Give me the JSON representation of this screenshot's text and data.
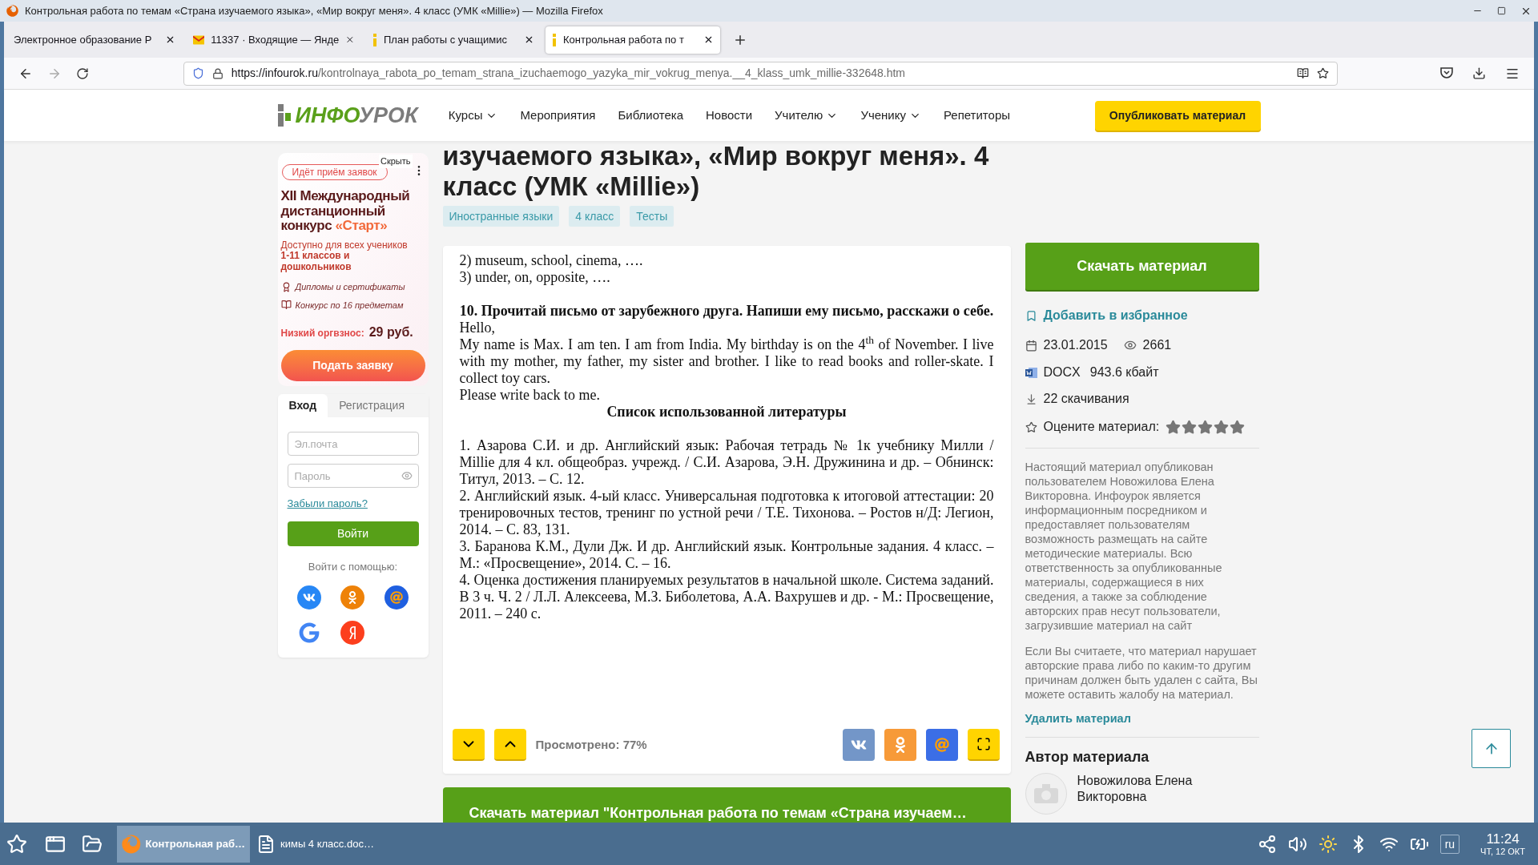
{
  "window": {
    "title": "Контрольная работа по темам «Страна изучаемого языка», «Мир вокруг меня». 4 класс (УМК «Millie») — Mozilla Firefox"
  },
  "tabs": [
    {
      "label": "Электронное образование Р",
      "selected": false,
      "kind": "none"
    },
    {
      "label": "11337 · Входящие — Янде",
      "selected": false,
      "kind": "mail"
    },
    {
      "label": "План работы с учащимис",
      "selected": false,
      "kind": "site"
    },
    {
      "label": "Контрольная работа по т",
      "selected": true,
      "kind": "site"
    }
  ],
  "address_bar": {
    "host": "https://infourok.ru",
    "path": "/kontrolnaya_rabota_po_temam_strana_izuchaemogo_yazyka_mir_vokrug_menya.__4_klass_umk_millie-332648.htm"
  },
  "site_header": {
    "logo": [
      "ИНФО",
      "УРОК"
    ],
    "nav": [
      {
        "label": "Курсы",
        "dropdown": true
      },
      {
        "label": "Мероприятия",
        "dropdown": false
      },
      {
        "label": "Библиотека",
        "dropdown": false
      },
      {
        "label": "Новости",
        "dropdown": false
      },
      {
        "label": "Учителю",
        "dropdown": true
      },
      {
        "label": "Ученику",
        "dropdown": true
      },
      {
        "label": "Репетиторы",
        "dropdown": false
      }
    ],
    "publish_button": "Опубликовать материал"
  },
  "ad": {
    "hide": "Скрыть",
    "badge": "Идёт приём заявок",
    "title": "XII Международный дистанционный конкурс",
    "title_accent": "«Старт»",
    "subtitle": "Доступно для всех учеников **1-11 классов и дошкольников**",
    "features": [
      {
        "kind": "diploma",
        "text": "Дипломы и сертификаты"
      },
      {
        "kind": "book",
        "text": "Конкурс по 16 предметам"
      }
    ],
    "fee_label": "Низкий оргвзнос:",
    "fee": "29 руб.",
    "button": "Подать заявку"
  },
  "login": {
    "tabs": [
      {
        "label": "Вход",
        "selected": true
      },
      {
        "label": "Регистрация",
        "selected": false
      }
    ],
    "email_placeholder": "Эл.почта",
    "password_placeholder": "Пароль",
    "forgot_link": "Забыли пароль?",
    "submit": "Войти",
    "social_label": "Войти с помощью:",
    "social": [
      {
        "kind": "vk"
      },
      {
        "kind": "ok"
      },
      {
        "kind": "mail"
      },
      {
        "kind": "google"
      },
      {
        "kind": "yandex"
      }
    ]
  },
  "material": {
    "title_lines": [
      "изучаемого языка», «Мир вокруг меня». 4",
      "класс (УМК «Millie»)"
    ],
    "tags": [
      "Иностранные языки",
      "4 класс",
      "Тесты"
    ]
  },
  "document": {
    "sections": [
      {
        "blocks": [
          {
            "kind": "plain",
            "text": "2) museum, school, cinema,  …."
          },
          {
            "kind": "plain",
            "text": "3)  under, on, opposite, …."
          }
        ]
      },
      {
        "blocks": [
          {
            "kind": "heading",
            "text": "10. Прочитай письмо от зарубежного друга. Напиши ему письмо, расскажи о себе."
          },
          {
            "kind": "plain",
            "text": "Hello,"
          },
          {
            "kind": "justified",
            "text": "My name is Max. I am ten. I am from India. My birthday is on the 4$^{th}$ of November. I live with my mother, my father, my sister and brother. I like to read books and roller-skate. I collect toy cars."
          },
          {
            "kind": "plain",
            "text": "Please write back to me."
          },
          {
            "kind": "heading",
            "text": "Список использованной литературы"
          }
        ]
      },
      {
        "blocks": [
          {
            "kind": "justified",
            "text": "1.   Азарова С.И. и др. Английский язык: Рабочая тетрадь № 1к учебнику Милли / Millie для 4 кл. общеобраз. учрежд. / С.И. Азарова, Э.Н. Дружинина и др. – Обнинск: Титул, 2013. – С. 12."
          },
          {
            "kind": "justified",
            "text": "2.      Английский язык. 4-ый класс. Универсальная подготовка к итоговой аттестации: 20 тренировочных тестов, тренинг по устной речи / Т.Е. Тихонова. – Ростов н/Д: Легион, 2014. – С. 83, 131."
          },
          {
            "kind": "justified",
            "text": "3.    Баранова К.М., Дули Дж. И др. Английский язык. Контрольные задания. 4 класс. – М.: «Просвещение», 2014. С. – 16."
          },
          {
            "kind": "justified",
            "text": "4.    Оценка достижения планируемых результатов в начальной школе. Система заданий. В 3 ч. Ч. 2 / Л.Л. Алексеева, М.З. Биболетова, А.А. Вахрушев и др. - М.: Просвещение, 2011. – 240 с."
          }
        ]
      }
    ]
  },
  "viewer": {
    "progress": "Просмотрено: 77%",
    "share": [
      {
        "kind": "vk"
      },
      {
        "kind": "ok"
      },
      {
        "kind": "mail"
      },
      {
        "kind": "fullscreen"
      }
    ]
  },
  "bottom_download": "Скачать материал \"Контрольная работа по темам «Страна изучаем…",
  "info": {
    "download_button": "Скачать материал",
    "favorite_link": "Добавить в избранное",
    "date": "23.01.2015",
    "views": "2661",
    "format": "DOCX",
    "size": "943.6 кбайт",
    "downloads": "22 скачивания",
    "rate_label": "Оцените материал:",
    "notice": [
      "Настоящий материал опубликован пользователем Новожилова Елена Викторовна. Инфоурок является информационным посредником и предоставляет пользователям возможность размещать на сайте методические материалы. Всю ответственность за опубликованные материалы, содержащиеся в них сведения, а также за соблюдение авторских прав несут пользователи, загрузившие материал на сайт",
      "Если Вы считаете, что материал нарушает авторские права либо по каким-то другим причинам должен быть удален с сайта, Вы можете оставить жалобу на материал."
    ],
    "delete_link": "Удалить материал",
    "author_heading": "Автор материала",
    "author_name": "Новожилова Елена Викторовна"
  },
  "taskbar": {
    "tasks": [
      {
        "label": "Контрольная раб…",
        "selected": true,
        "kind": "browser"
      },
      {
        "label": "кимы 4 класс.doc…",
        "selected": false,
        "kind": "document"
      }
    ],
    "layout": "ru",
    "time": "11:24",
    "date": "ЧТ, 12 ОКТ"
  }
}
